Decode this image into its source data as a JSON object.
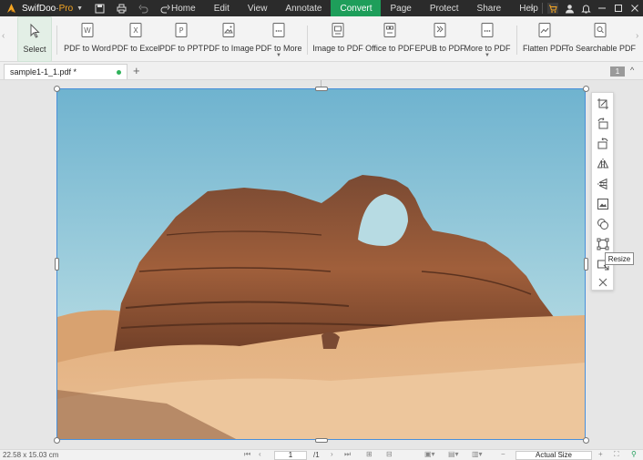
{
  "app": {
    "name": "SwifDoo",
    "edition": "Pro",
    "dropdown": "▼"
  },
  "menu": [
    "Home",
    "Edit",
    "View",
    "Annotate",
    "Convert",
    "Page",
    "Protect",
    "Share",
    "Help"
  ],
  "menu_active": "Convert",
  "ribbon": {
    "select": "Select",
    "pdf_to_word": "PDF to Word",
    "pdf_to_excel": "PDF to Excel",
    "pdf_to_ppt": "PDF to PPT",
    "pdf_to_image": "PDF to Image",
    "pdf_to_more": "PDF to More",
    "image_to_pdf": "Image to PDF",
    "office_to_pdf": "Office to PDF",
    "epub_to_pdf": "EPUB to PDF",
    "more_to_pdf": "More to PDF",
    "flatten_pdf": "Flatten PDF",
    "to_searchable_pdf": "To Searchable PDF"
  },
  "tab": {
    "name": "sample1-1_1.pdf *",
    "add": "+"
  },
  "page_badge": "1",
  "tooltip": "Resize",
  "status": {
    "size": "22.58 x 15.03 cm",
    "page_current": "1",
    "page_total": "/1",
    "zoom": "Actual Size"
  },
  "colors": {
    "accent": "#1e9e5a",
    "titlebar": "#2b2b2b",
    "selection": "#4a90d9"
  }
}
